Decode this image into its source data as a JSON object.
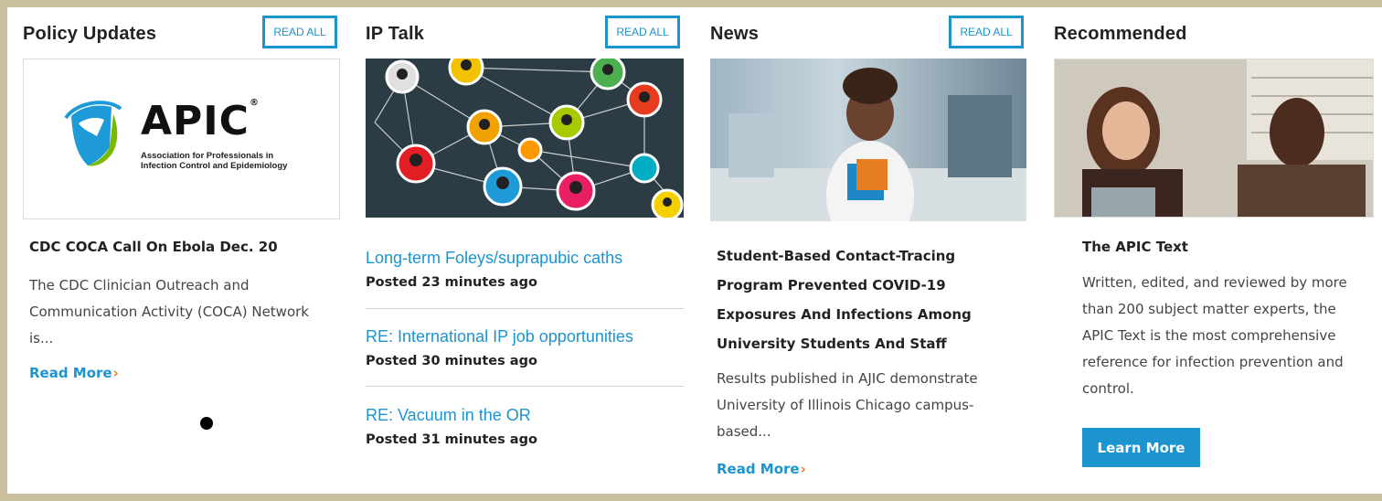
{
  "policy": {
    "title": "Policy Updates",
    "read_all": "READ ALL",
    "logo_wordmark": "APIC",
    "logo_registered": "®",
    "logo_subtitle_1": "Association for Professionals in",
    "logo_subtitle_2": "Infection Control and Epidemiology",
    "card_title": "CDC COCA Call On Ebola Dec. 20",
    "excerpt": "The CDC Clinician Outreach and Communication Activity (COCA) Network is...",
    "read_more": "Read More"
  },
  "iptalk": {
    "title": "IP Talk",
    "read_all": "READ ALL",
    "posts": [
      {
        "title": "Long-term Foleys/suprapubic caths",
        "meta": "Posted 23 minutes ago"
      },
      {
        "title": "RE: International IP job opportunities",
        "meta": "Posted 30 minutes ago"
      },
      {
        "title": "RE: Vacuum in the OR",
        "meta": "Posted 31 minutes ago"
      }
    ]
  },
  "news": {
    "title": "News",
    "read_all": "READ ALL",
    "card_title": "Student-Based Contact-Tracing Program Prevented COVID-19 Exposures And Infections Among University Students And Staff",
    "excerpt": "Results published in AJIC demonstrate University of Illinois Chicago campus-based...",
    "read_more": "Read More"
  },
  "recommended": {
    "title": "Recommended",
    "card_title": "The APIC Text",
    "excerpt": "Written, edited, and reviewed by more than 200 subject matter experts, the APIC Text is the most comprehensive reference for infection prevention and control.",
    "button": "Learn More"
  },
  "colors": {
    "accent": "#1b94cf",
    "chevron": "#e67e22",
    "frame": "#c9bf9f"
  }
}
